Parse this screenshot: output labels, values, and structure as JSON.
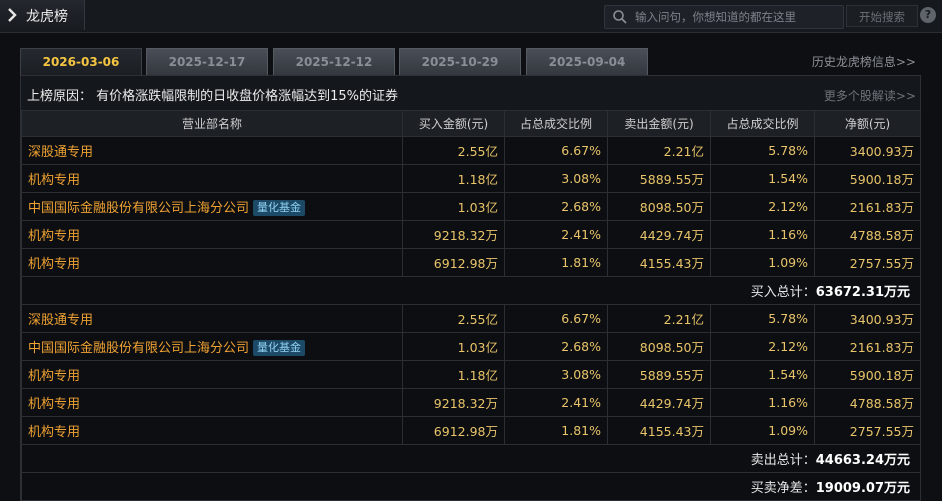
{
  "header": {
    "title": "龙虎榜",
    "search_placeholder": "输入问句，你想知道的都在这里",
    "search_button": "开始搜索",
    "help": "?"
  },
  "tabs": [
    "2026-03-06",
    "2025-12-17",
    "2025-12-12",
    "2025-10-29",
    "2025-09-04"
  ],
  "active_tab_index": 0,
  "history_link": "历史龙虎榜信息>>",
  "reason": "上榜原因： 有价格涨跌幅限制的日收盘价格涨幅达到15%的证券",
  "more_link": "更多个股解读>>",
  "columns": [
    "营业部名称",
    "买入金额(元)",
    "占总成交比例",
    "卖出金额(元)",
    "占总成交比例",
    "净额(元)"
  ],
  "buy_rows": [
    {
      "name": "深股通专用",
      "badge": "",
      "buy": "2.55亿",
      "buy_pct": "6.67%",
      "sell": "2.21亿",
      "sell_pct": "5.78%",
      "net": "3400.93万"
    },
    {
      "name": "机构专用",
      "badge": "",
      "buy": "1.18亿",
      "buy_pct": "3.08%",
      "sell": "5889.55万",
      "sell_pct": "1.54%",
      "net": "5900.18万"
    },
    {
      "name": "中国国际金融股份有限公司上海分公司",
      "badge": "量化基金",
      "buy": "1.03亿",
      "buy_pct": "2.68%",
      "sell": "8098.50万",
      "sell_pct": "2.12%",
      "net": "2161.83万"
    },
    {
      "name": "机构专用",
      "badge": "",
      "buy": "9218.32万",
      "buy_pct": "2.41%",
      "sell": "4429.74万",
      "sell_pct": "1.16%",
      "net": "4788.58万"
    },
    {
      "name": "机构专用",
      "badge": "",
      "buy": "6912.98万",
      "buy_pct": "1.81%",
      "sell": "4155.43万",
      "sell_pct": "1.09%",
      "net": "2757.55万"
    }
  ],
  "buy_total_label": "买入总计：",
  "buy_total_value": "63672.31万元",
  "sell_rows": [
    {
      "name": "深股通专用",
      "badge": "",
      "buy": "2.55亿",
      "buy_pct": "6.67%",
      "sell": "2.21亿",
      "sell_pct": "5.78%",
      "net": "3400.93万"
    },
    {
      "name": "中国国际金融股份有限公司上海分公司",
      "badge": "量化基金",
      "buy": "1.03亿",
      "buy_pct": "2.68%",
      "sell": "8098.50万",
      "sell_pct": "2.12%",
      "net": "2161.83万"
    },
    {
      "name": "机构专用",
      "badge": "",
      "buy": "1.18亿",
      "buy_pct": "3.08%",
      "sell": "5889.55万",
      "sell_pct": "1.54%",
      "net": "5900.18万"
    },
    {
      "name": "机构专用",
      "badge": "",
      "buy": "9218.32万",
      "buy_pct": "2.41%",
      "sell": "4429.74万",
      "sell_pct": "1.16%",
      "net": "4788.58万"
    },
    {
      "name": "机构专用",
      "badge": "",
      "buy": "6912.98万",
      "buy_pct": "1.81%",
      "sell": "4155.43万",
      "sell_pct": "1.09%",
      "net": "2757.55万"
    }
  ],
  "sell_total_label": "卖出总计：",
  "sell_total_value": "44663.24万元",
  "net_total_label": "买卖净差：",
  "net_total_value": "19009.07万元",
  "colors": {
    "accent": "#f5c542",
    "name": "#f0a233",
    "value": "#e9c46a",
    "badge_bg": "#1c4a66"
  }
}
